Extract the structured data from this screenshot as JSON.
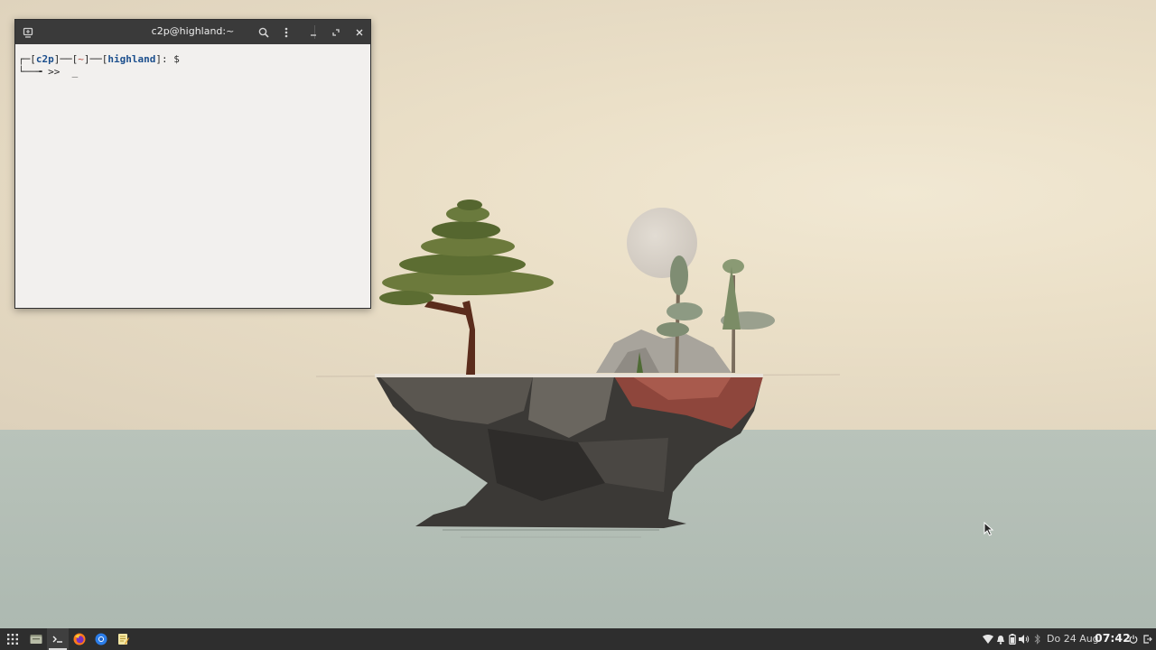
{
  "terminal": {
    "title": "c2p@highland:~",
    "prompt": {
      "corner_open": "┌─[",
      "user": "c2p",
      "sep1": "]──[",
      "path": "~",
      "sep2": "]──[",
      "host": "highland",
      "end": "]: $",
      "line2_prefix": "└──╼ >>  ",
      "cursor": "_"
    }
  },
  "taskbar": {
    "apps": [
      {
        "name": "app-grid",
        "icon": "app-grid-icon"
      },
      {
        "name": "files",
        "icon": "folder-icon"
      },
      {
        "name": "terminal",
        "icon": "terminal-icon",
        "active": true
      },
      {
        "name": "firefox",
        "icon": "firefox-icon"
      },
      {
        "name": "chromium",
        "icon": "browser-icon"
      },
      {
        "name": "text-editor",
        "icon": "text-editor-icon"
      }
    ],
    "tray": [
      "wifi-icon",
      "bell-icon",
      "battery-icon",
      "volume-icon",
      "bluetooth-icon"
    ],
    "date": "Do 24 Aug",
    "time": "07:42"
  },
  "colors": {
    "taskbar_bg": "#2e2e2e",
    "titlebar_bg": "#3a3a3a",
    "terminal_bg": "#f2f0ee",
    "prompt_blue": "#1c4f8d",
    "prompt_red": "#b8473b"
  }
}
